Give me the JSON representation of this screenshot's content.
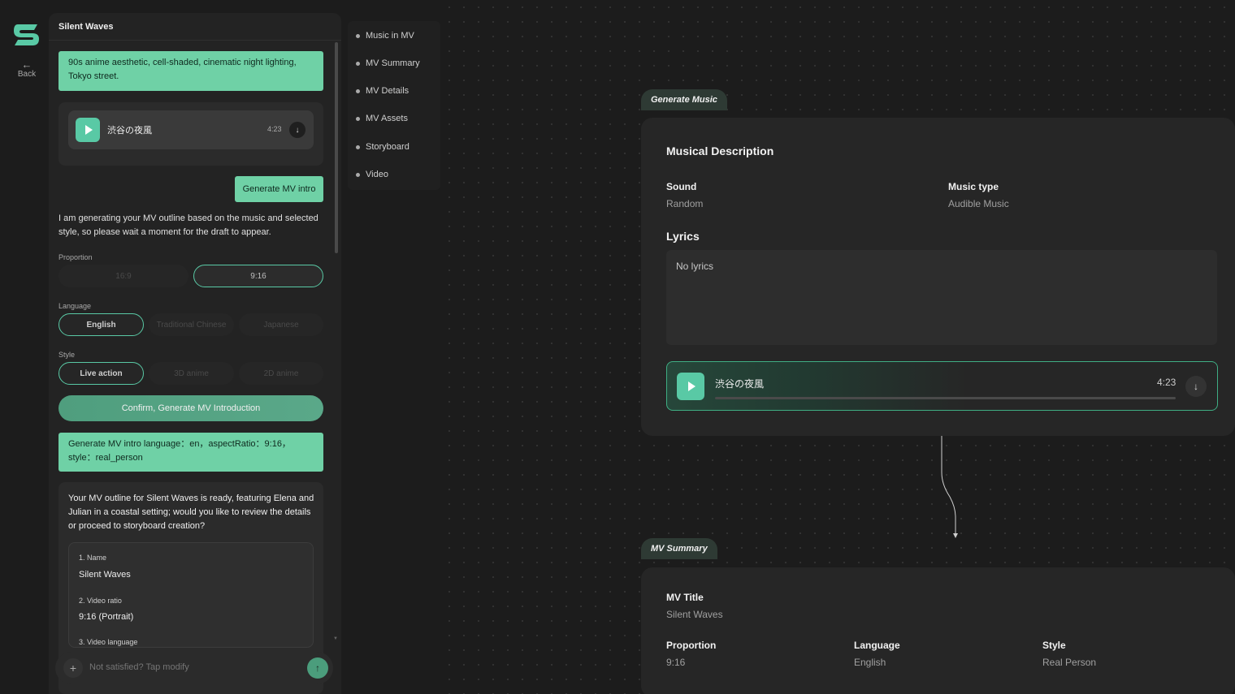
{
  "sidebar": {
    "back_label": "Back"
  },
  "chat": {
    "title": "Silent Waves",
    "prompt_bubble": "90s anime aesthetic, cell-shaded, cinematic night lighting, Tokyo street.",
    "music_card": {
      "track_name": "渋谷の夜風",
      "duration": "4:23"
    },
    "generate_intro_bubble": "Generate MV intro",
    "status_message": "I am generating your MV outline based on the music and selected style, so please wait a moment for the draft to appear.",
    "proportion": {
      "label": "Proportion",
      "options": [
        "16:9",
        "9:16"
      ],
      "selected": "9:16"
    },
    "language": {
      "label": "Language",
      "options": [
        "English",
        "Traditional Chinese",
        "Japanese"
      ],
      "selected": "English"
    },
    "style": {
      "label": "Style",
      "options": [
        "Live action",
        "3D anime",
        "2D anime"
      ],
      "selected": "Live action"
    },
    "confirm_label": "Confirm, Generate MV Introduction",
    "intro_request_bubble": "Generate MV intro language：en，aspectRatio：9:16，style：real_person",
    "outline_message": "Your MV outline for Silent Waves is ready, featuring Elena and Julian in a coastal setting; would you like to review the details or proceed to storyboard creation?",
    "outline_items": [
      {
        "label": "1. Name",
        "value": "Silent Waves"
      },
      {
        "label": "2. Video ratio",
        "value": "9:16 (Portrait)"
      },
      {
        "label": "3. Video language",
        "value": ""
      }
    ],
    "input": {
      "placeholder": "Not satisfied? Tap modify"
    }
  },
  "nav": {
    "items": [
      "Music in MV",
      "MV Summary",
      "MV Details",
      "MV Assets",
      "Storyboard",
      "Video"
    ]
  },
  "canvas": {
    "generate_music": {
      "tag": "Generate Music",
      "heading": "Musical Description",
      "sound_label": "Sound",
      "sound_value": "Random",
      "music_type_label": "Music type",
      "music_type_value": "Audible Music",
      "lyrics_label": "Lyrics",
      "lyrics_value": "No lyrics",
      "player": {
        "track_name": "渋谷の夜風",
        "duration": "4:23"
      }
    },
    "mv_summary": {
      "tag": "MV Summary",
      "title_label": "MV Title",
      "title_value": "Silent Waves",
      "proportion_label": "Proportion",
      "proportion_value": "9:16",
      "language_label": "Language",
      "language_value": "English",
      "style_label": "Style",
      "style_value": "Real Person"
    }
  },
  "colors": {
    "accent": "#59c9a5",
    "bubble": "#6fd1a6",
    "background": "#1c1c1c"
  }
}
